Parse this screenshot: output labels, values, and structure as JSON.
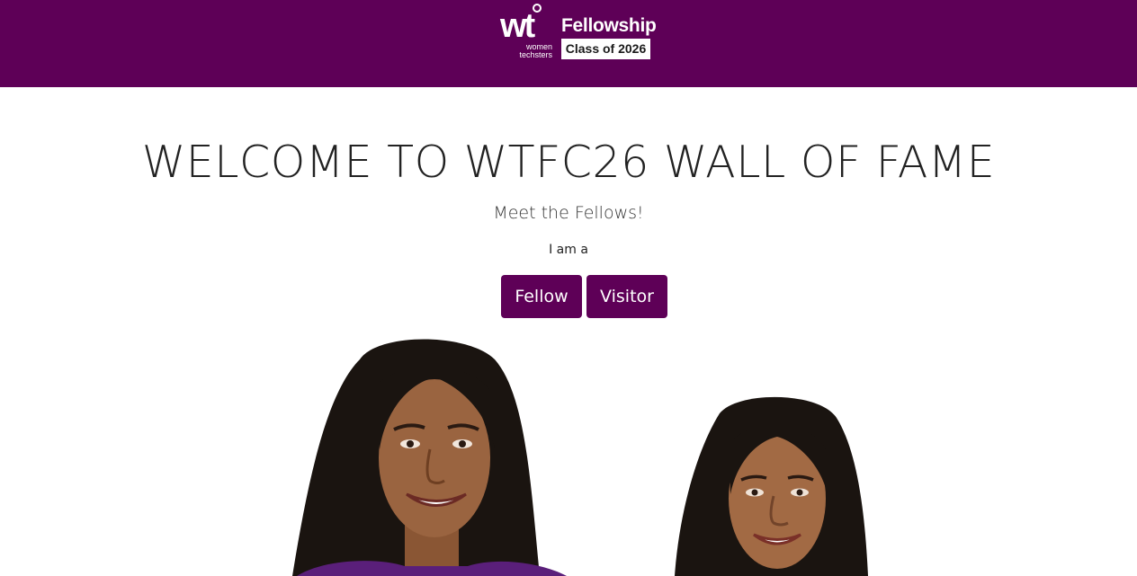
{
  "header": {
    "logo": {
      "mark": "wt",
      "sub_line1": "women",
      "sub_line2": "techsters",
      "program": "Fellowship",
      "cohort": "Class of 2026"
    },
    "background_color": "#5e0057"
  },
  "main": {
    "title": "WELCOME TO WTFC26 WALL OF FAME",
    "subtitle": "Meet the Fellows!",
    "prompt": "I am a",
    "buttons": {
      "fellow_label": "Fellow",
      "visitor_label": "Visitor"
    },
    "accent_color": "#5e0057"
  }
}
